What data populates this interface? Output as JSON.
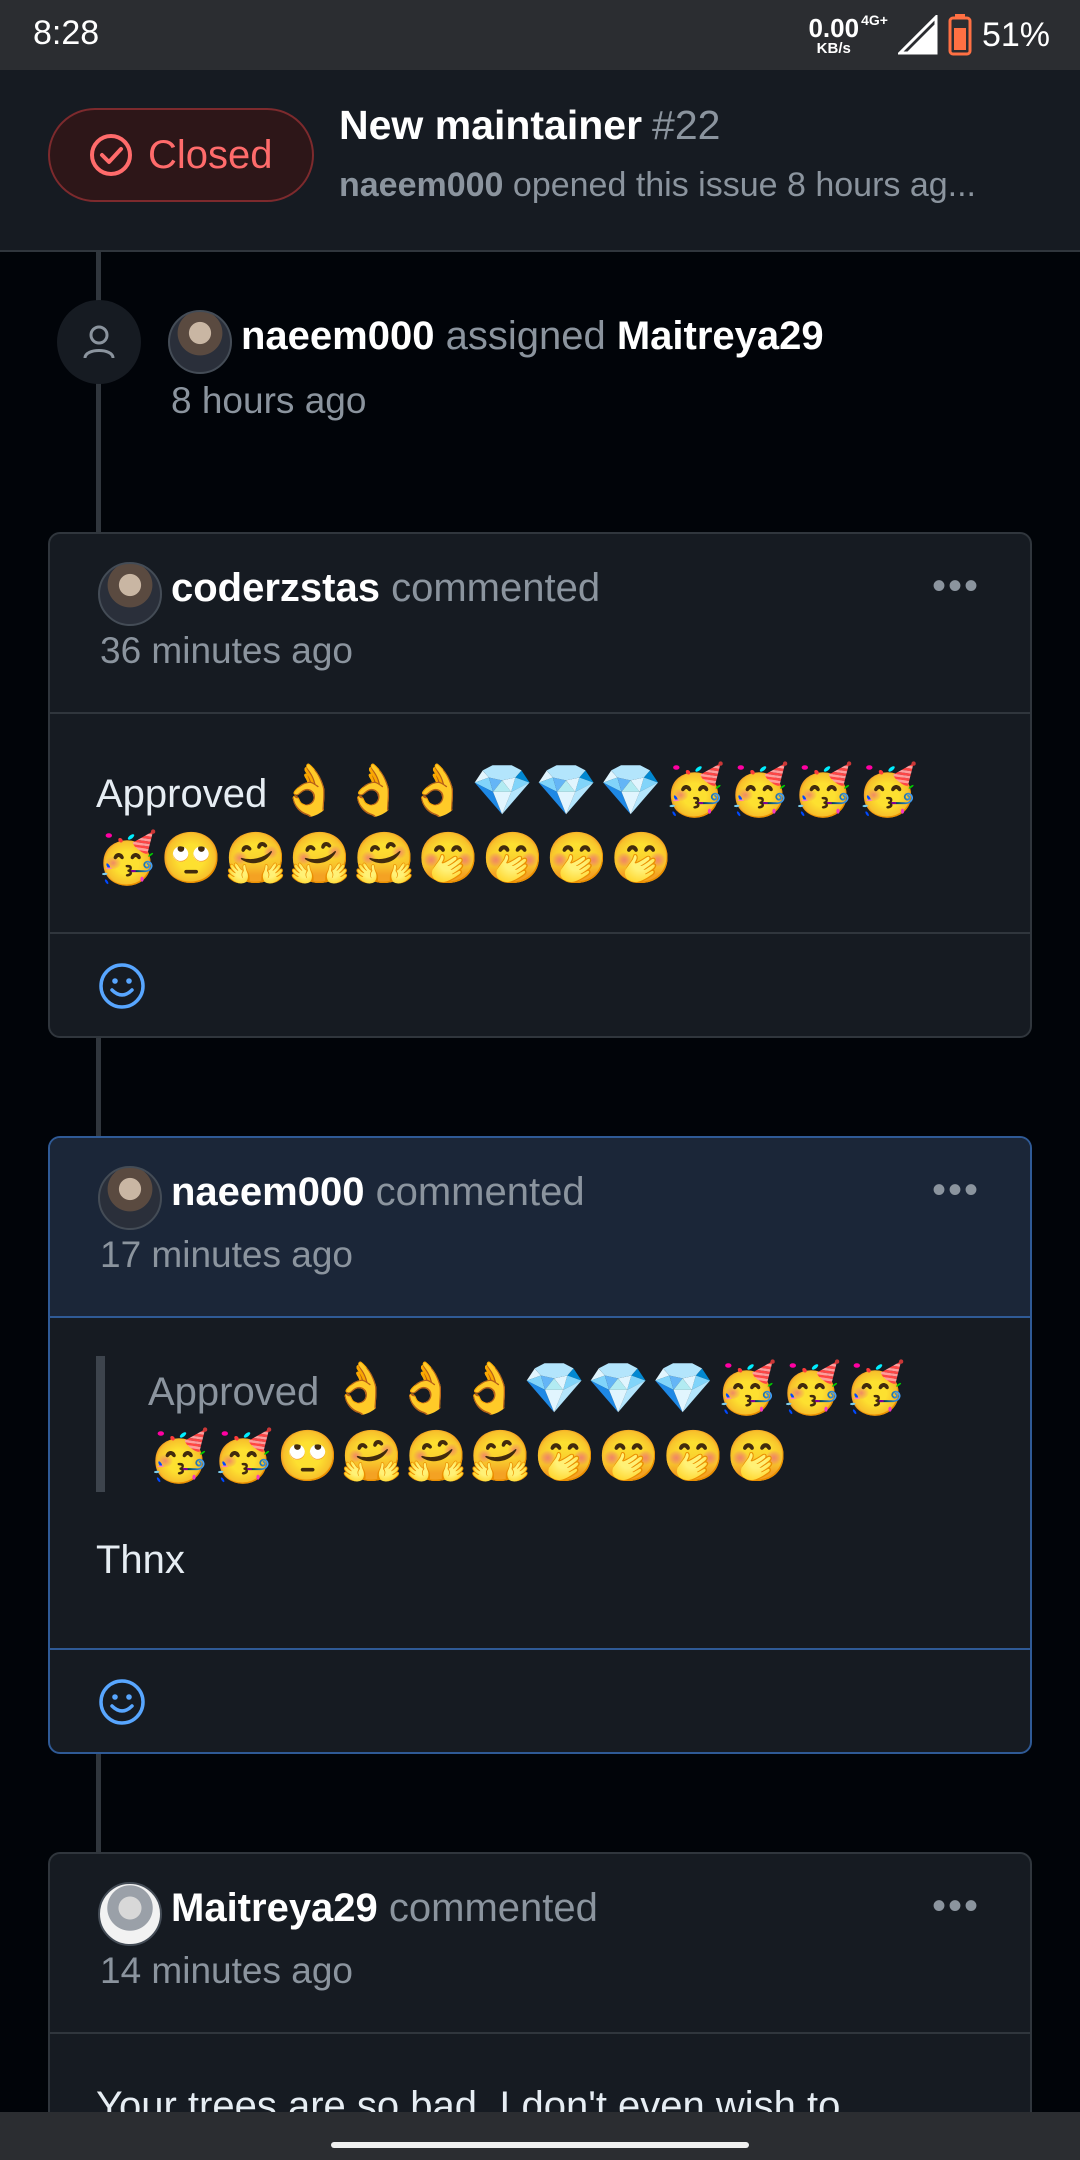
{
  "status_bar": {
    "time": "8:28",
    "net_speed": "0.00",
    "net_unit": "KB/s",
    "network": "4G+",
    "battery": "51%"
  },
  "issue": {
    "state": "Closed",
    "title": "New maintainer",
    "number": "#22",
    "opened_by": "naeem000",
    "opened_text": "opened this issue 8 hours ag..."
  },
  "timeline_event": {
    "actor": "naeem000",
    "action": "assigned",
    "target": "Maitreya29",
    "time": "8 hours ago"
  },
  "comments": [
    {
      "author": "coderzstas",
      "verb": "commented",
      "time": "36 minutes ago",
      "menu": "•••",
      "text": "Approved",
      "emojis_line1": "👌👌👌💎💎💎🥳🥳🥳🥳",
      "emojis_line2": "🥳🙄🤗🤗🤗🤭🤭🤭🤭"
    },
    {
      "author": "naeem000",
      "verb": "commented",
      "time": "17 minutes ago",
      "menu": "•••",
      "quote_text": "Approved",
      "quote_emojis_line1": "👌👌👌💎💎💎🥳🥳🥳",
      "quote_emojis_line2": "🥳🥳🙄🤗🤗🤗🤭🤭🤭🤭",
      "text": "Thnx"
    },
    {
      "author": "Maitreya29",
      "verb": "commented",
      "time": "14 minutes ago",
      "menu": "•••",
      "text": "Your trees are so bad. I don't even wish to"
    }
  ],
  "colors": {
    "background": "#010409",
    "surface": "#161b22",
    "border": "#30363d",
    "closed_red": "#ff6b6b",
    "link_blue": "#58a6ff",
    "highlight_border": "#2f5a96"
  }
}
